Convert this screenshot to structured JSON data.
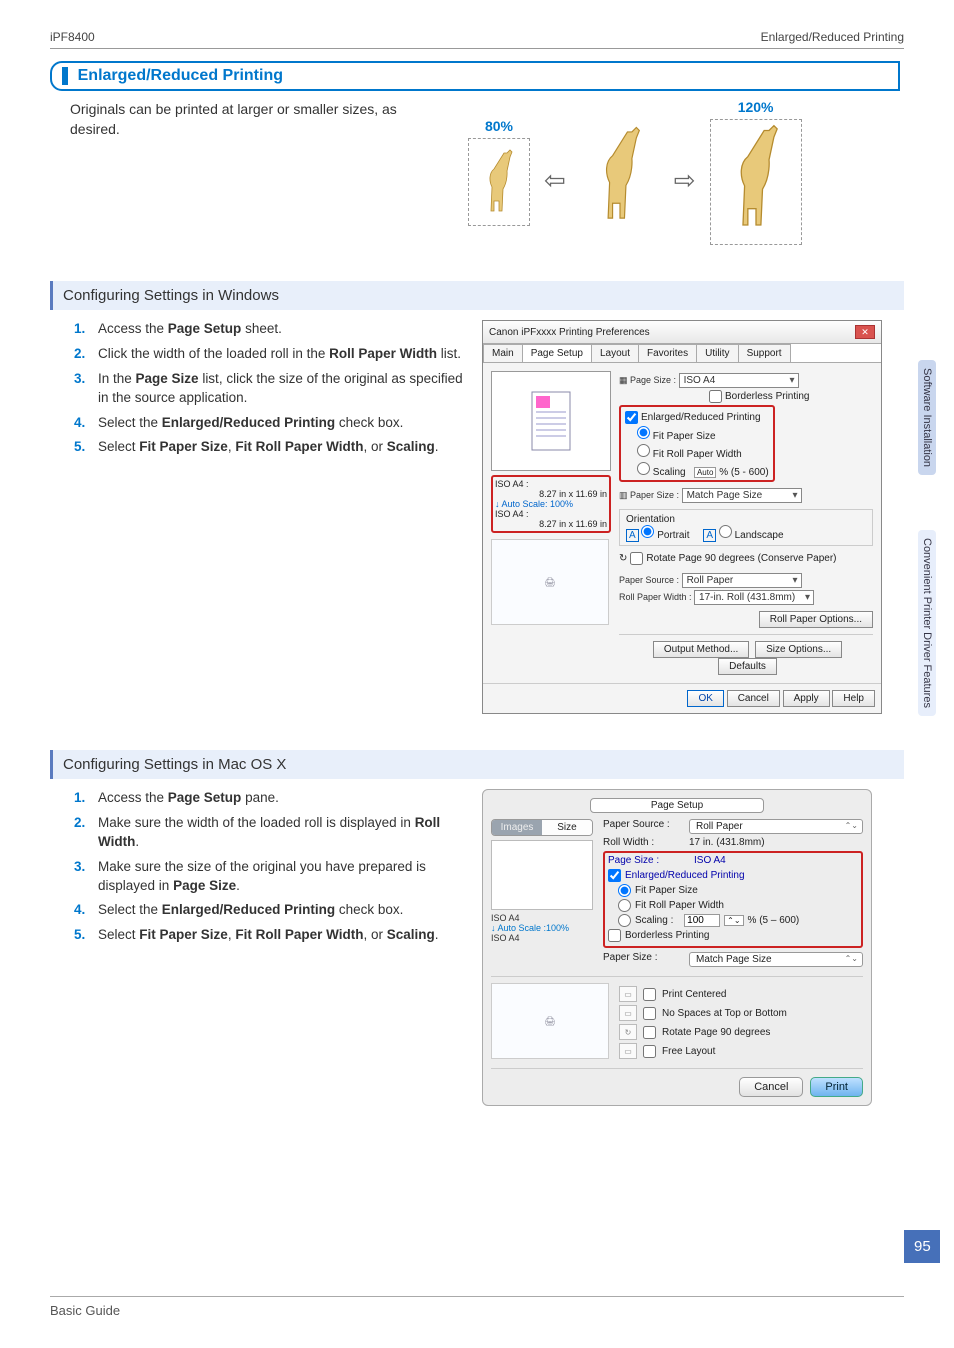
{
  "header": {
    "left": "iPF8400",
    "right": "Enlarged/Reduced Printing"
  },
  "section_title": "Enlarged/Reduced Printing",
  "intro_text": "Originals can be printed at larger or smaller sizes, as desired.",
  "scale_labels": {
    "small": "80%",
    "large": "120%"
  },
  "side_tabs": {
    "t1": "Software Installation",
    "t2": "Convenient Printer Driver Features"
  },
  "page_number": "95",
  "footer": "Basic Guide",
  "windows": {
    "heading": "Configuring Settings in Windows",
    "steps": [
      {
        "n": "1.",
        "pre": "Access the ",
        "b1": "Page Setup",
        "post": " sheet."
      },
      {
        "n": "2.",
        "pre": "Click the width of the loaded roll in the ",
        "b1": "Roll Paper Width",
        "post": " list."
      },
      {
        "n": "3.",
        "pre": "In the ",
        "b1": "Page Size",
        "post": " list, click the size of the original as specified in the source application."
      },
      {
        "n": "4.",
        "pre": "Select the ",
        "b1": "Enlarged/Reduced Printing",
        "post": " check box."
      },
      {
        "n": "5.",
        "pre": "Select ",
        "b1": "Fit Paper Size",
        "mid": ", ",
        "b2": "Fit Roll Paper Width",
        "mid2": ", or ",
        "b3": "Scaling",
        "post": "."
      }
    ],
    "dialog": {
      "title": "Canon iPFxxxx Printing Preferences",
      "tabs": [
        "Main",
        "Page Setup",
        "Layout",
        "Favorites",
        "Utility",
        "Support"
      ],
      "active_tab": 1,
      "page_size_label": "Page Size :",
      "page_size_value": "ISO A4",
      "borderless": "Borderless Printing",
      "enlarged_cb": "Enlarged/Reduced Printing",
      "fit_paper": "Fit Paper Size",
      "fit_roll": "Fit Roll Paper Width",
      "scaling": "Scaling",
      "scaling_auto": "Auto",
      "scaling_range": "% (5 - 600)",
      "paper_size_label": "Paper Size :",
      "paper_size_value": "Match Page Size",
      "orientation_label": "Orientation",
      "portrait": "Portrait",
      "landscape": "Landscape",
      "rotate": "Rotate Page 90 degrees (Conserve Paper)",
      "paper_source_label": "Paper Source :",
      "paper_source_value": "Roll Paper",
      "roll_width_label": "Roll Paper Width :",
      "roll_width_value": "17-in. Roll (431.8mm)",
      "roll_options_btn": "Roll Paper Options...",
      "output_btn": "Output Method...",
      "size_options_btn": "Size Options...",
      "defaults_btn": "Defaults",
      "ok": "OK",
      "cancel": "Cancel",
      "apply": "Apply",
      "help": "Help",
      "left_info1": "ISO A4 :",
      "left_info1b": "8.27 in x 11.69 in",
      "left_info_auto": "Auto Scale: 100%",
      "left_info2": "ISO A4 :",
      "left_info2b": "8.27 in x 11.69 in"
    }
  },
  "mac": {
    "heading": "Configuring Settings in Mac OS X",
    "steps": [
      {
        "n": "1.",
        "pre": "Access the ",
        "b1": "Page Setup",
        "post": " pane."
      },
      {
        "n": "2.",
        "pre": "Make sure the width of the loaded roll is displayed in ",
        "b1": "Roll Width",
        "post": "."
      },
      {
        "n": "3.",
        "pre": "Make sure the size of the original you have prepared is displayed in ",
        "b1": "Page Size",
        "post": "."
      },
      {
        "n": "4.",
        "pre": "Select the ",
        "b1": "Enlarged/Reduced Printing",
        "post": " check box."
      },
      {
        "n": "5.",
        "pre": "Select ",
        "b1": "Fit Paper Size",
        "mid": ", ",
        "b2": "Fit Roll Paper Width",
        "mid2": ", or ",
        "b3": "Scaling",
        "post": "."
      }
    ],
    "dialog": {
      "top_dropdown": "Page Setup",
      "tabs": [
        "Images",
        "Size"
      ],
      "paper_source_label": "Paper Source :",
      "paper_source_value": "Roll Paper",
      "roll_width_label": "Roll Width :",
      "roll_width_value": "17 in. (431.8mm)",
      "page_size_label": "Page Size :",
      "page_size_value": "ISO A4",
      "enlarged_cb": "Enlarged/Reduced Printing",
      "fit_paper": "Fit Paper Size",
      "fit_roll": "Fit Roll Paper Width",
      "scaling": "Scaling :",
      "scaling_value": "100",
      "scaling_range": "% (5 – 600)",
      "borderless": "Borderless Printing",
      "paper_size2_label": "Paper Size :",
      "paper_size2_value": "Match Page Size",
      "print_centered": "Print Centered",
      "no_spaces": "No Spaces at Top or Bottom",
      "rotate": "Rotate Page 90 degrees",
      "free_layout": "Free Layout",
      "left_info1": "ISO A4",
      "left_auto": "Auto Scale :100%",
      "left_info2": "ISO A4",
      "cancel": "Cancel",
      "print": "Print"
    }
  }
}
